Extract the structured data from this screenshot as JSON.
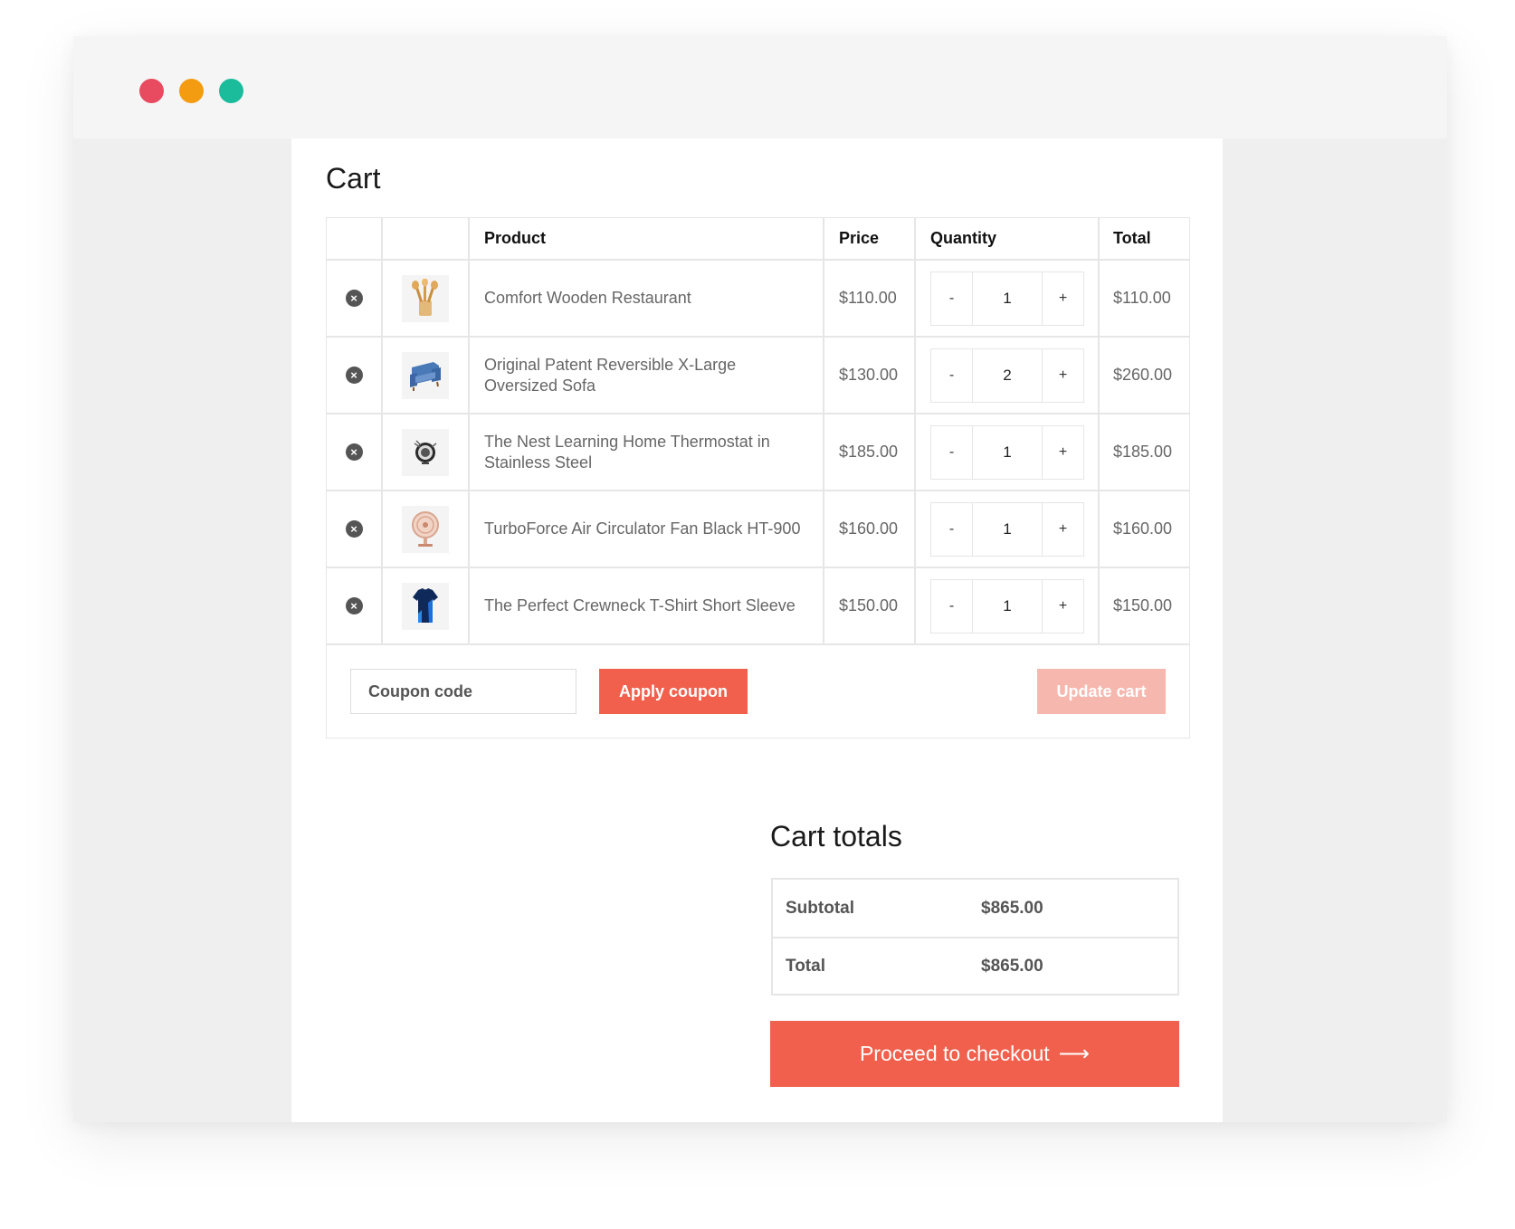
{
  "window": {
    "controls": [
      "close",
      "minimize",
      "maximize"
    ]
  },
  "cart": {
    "title": "Cart",
    "columns": {
      "product": "Product",
      "price": "Price",
      "quantity": "Quantity",
      "total": "Total"
    },
    "items": [
      {
        "name": "Comfort Wooden Restaurant",
        "price": "$110.00",
        "qty": "1",
        "total": "$110.00",
        "thumb_icon": "wooden-utensils-icon"
      },
      {
        "name": "Original Patent Reversible X-Large Oversized Sofa",
        "price": "$130.00",
        "qty": "2",
        "total": "$260.00",
        "thumb_icon": "sofa-icon"
      },
      {
        "name": "The Nest Learning Home Thermostat in Stainless Steel",
        "price": "$185.00",
        "qty": "1",
        "total": "$185.00",
        "thumb_icon": "thermostat-icon"
      },
      {
        "name": "TurboForce Air Circulator Fan Black HT-900",
        "price": "$160.00",
        "qty": "1",
        "total": "$160.00",
        "thumb_icon": "fan-icon"
      },
      {
        "name": "The Perfect Crewneck T-Shirt Short Sleeve",
        "price": "$150.00",
        "qty": "1",
        "total": "$150.00",
        "thumb_icon": "tshirt-icon"
      }
    ],
    "qty_minus": "-",
    "qty_plus": "+",
    "remove_symbol": "×",
    "coupon": {
      "placeholder": "Coupon code",
      "apply_label": "Apply coupon"
    },
    "update_label": "Update cart"
  },
  "totals": {
    "title": "Cart totals",
    "subtotal_label": "Subtotal",
    "subtotal_value": "$865.00",
    "total_label": "Total",
    "total_value": "$865.00",
    "checkout_label": "Proceed to checkout",
    "checkout_arrow": "⟶"
  },
  "colors": {
    "accent": "#f0604d",
    "accent_disabled": "#f6b7ae",
    "dot_red": "#e84a5f",
    "dot_orange": "#f39c12",
    "dot_green": "#1abc9c"
  }
}
